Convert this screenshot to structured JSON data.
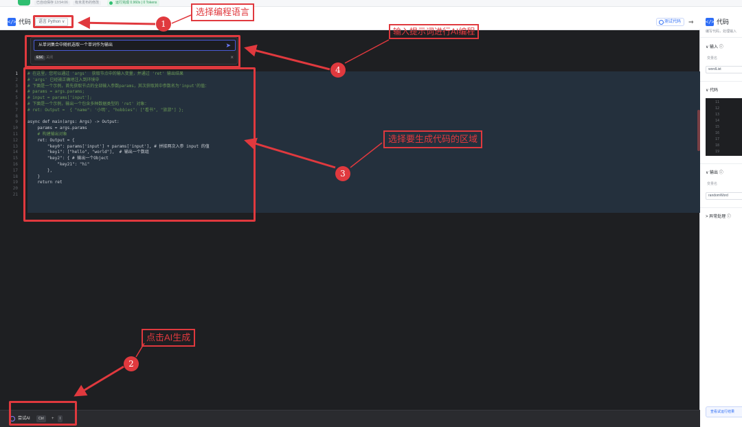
{
  "topbar": {
    "autosave": "已自动保存 13:54:06",
    "unpublished": "有未发布的修改",
    "run_status": "运行完成 0.960s | 0 Tokens"
  },
  "editor": {
    "title": "代码",
    "language": "语言 Python ∨",
    "test_code": "测试代码",
    "collapse_icon": "⇒",
    "ai_prompt_value": "从单词集合中随机选取一个单词作为输出",
    "send_icon": "➤",
    "esc_key": "ESC",
    "esc_label": "关闭",
    "close_icon": "×",
    "code_lines": [
      "# 在这里，您可以通过 'args'  获取节点中的输入变量，并通过 'ret' 输出结果",
      "# 'args' 已经被正确地注入到环境中",
      "# 下面是一个示例，首先获取节点的全部输入参数params，其次获取其中参数名为'input'的值：",
      "# params = args.params;",
      "# input = params['input'];",
      "# 下面是一个示例，输出一个包含多种数据类型的 'ret' 对象：",
      "# ret: Output =  { \"name\": '小明', \"hobbies\": [\"看书\", \"旅游\"] };",
      "",
      "async def main(args: Args) -> Output:",
      "    params = args.params",
      "    # 构建输出对象",
      "    ret: Output = {",
      "        \"key0\": params['input'] + params['input'], # 拼接两次入参 input 的值",
      "        \"key1\": [\"hello\", \"world\"],  # 输出一个数组",
      "        \"key2\": { # 输出一个Object ",
      "            \"key21\": \"hi\"",
      "        },",
      "    }",
      "    return ret",
      "",
      ""
    ],
    "try_ai": "尝试AI",
    "kbd_ctrl": "Ctrl",
    "kbd_plus": "+",
    "kbd_i": "I"
  },
  "right_panel": {
    "title": "代码",
    "desc": "编写代码，处理输入",
    "input_section": "∨  输入 ⓘ",
    "input_sub": "变量名",
    "input_var": "wordList",
    "code_section": "∨  代码",
    "code_line_numbers": [
      "11",
      "12",
      "13",
      "14",
      "15",
      "16",
      "17",
      "18",
      "19"
    ],
    "output_section": "∨  输出 ⓘ",
    "output_sub": "变量名",
    "output_var": "randomWord",
    "exception_section": ">  异常处理 ⓘ",
    "view_result": "查看试运行结果"
  },
  "annotations": {
    "c1_label": "选择编程语言",
    "c2_label": "点击AI生成",
    "c3_label": "选择要生成代码的区域",
    "c4_label": "输入提示词进行AI编程",
    "badge1": "1",
    "badge2": "2",
    "badge3": "3",
    "badge4": "4",
    "color": "#e0393e"
  }
}
